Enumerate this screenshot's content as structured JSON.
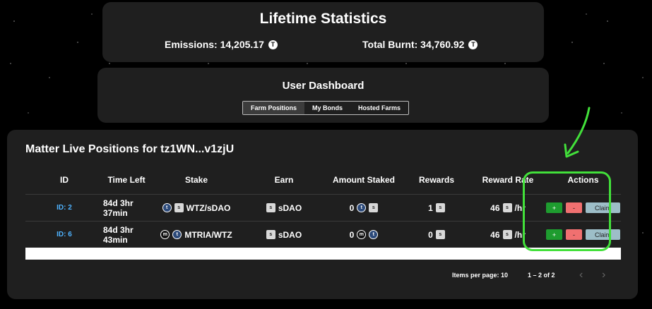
{
  "stats": {
    "title": "Lifetime Statistics",
    "emissions_label": "Emissions: 14,205.17",
    "burnt_label": "Total Burnt: 34,760.92",
    "coin_symbol": "T"
  },
  "dashboard": {
    "title": "User Dashboard",
    "tabs": [
      {
        "label": "Farm Positions",
        "active": true
      },
      {
        "label": "My Bonds",
        "active": false
      },
      {
        "label": "Hosted Farms",
        "active": false
      }
    ]
  },
  "positions": {
    "title": "Matter Live Positions for tz1WN...v1zjU",
    "columns": [
      "ID",
      "Time Left",
      "Stake",
      "Earn",
      "Amount Staked",
      "Rewards",
      "Reward Rate",
      "Actions"
    ],
    "rows": [
      {
        "id": "ID: 2",
        "time_left": "84d 3hr 37min",
        "stake": "WTZ/sDAO",
        "stake_icons": [
          "wtz-token-icon",
          "sdao-token-icon"
        ],
        "earn": "sDAO",
        "amount_staked": "0",
        "rewards": "1",
        "reward_rate": "46",
        "rate_unit": "/hr"
      },
      {
        "id": "ID: 6",
        "time_left": "84d 3hr 43min",
        "stake": "MTRIA/WTZ",
        "stake_icons": [
          "mtria-token-icon",
          "wtz-token-icon"
        ],
        "earn": "sDAO",
        "amount_staked": "0",
        "rewards": "0",
        "reward_rate": "46",
        "rate_unit": "/hr"
      }
    ],
    "actions": {
      "plus": "+",
      "minus": "-",
      "claim": "Claim"
    },
    "pagination": {
      "items_per_page_label": "Items per page:",
      "items_per_page_value": "10",
      "range": "1 – 2 of 2",
      "prev_icon": "chevron-left-icon",
      "next_icon": "chevron-right-icon"
    }
  },
  "annotation": {
    "color": "#42e03a"
  }
}
